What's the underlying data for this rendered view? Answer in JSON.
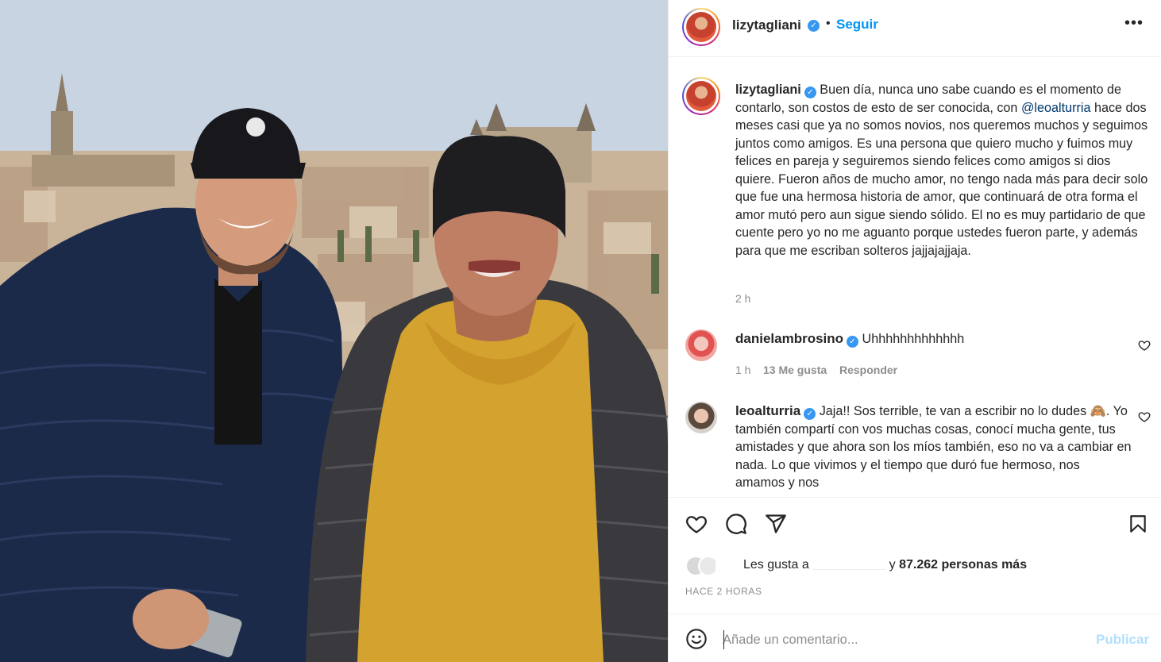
{
  "post": {
    "username": "lizytagliani",
    "follow_label": "Seguir",
    "dot": "•",
    "more_icon": "more-horizontal-icon",
    "caption_text": "Buen día, nunca uno sabe cuando es el momento de contarlo, son costos de esto de ser conocida, con",
    "caption_mention": "@leoalturria",
    "caption_rest": "hace dos meses casi que ya no somos novios, nos queremos muchos y seguimos juntos como amigos. Es una persona que quiero mucho y fuimos muy felices en pareja y seguiremos siendo felices como amigos si dios quiere. Fueron años de mucho amor, no tengo nada más para decir solo que fue una hermosa historia de amor, que continuará de otra forma el amor mutó pero aun sigue siendo sólido. El no es muy partidario de que cuente pero yo no me aguanto porque ustedes fueron parte, y además para que me escriban solteros jajjajajjaja.",
    "caption_time": "2 h"
  },
  "comments": [
    {
      "username": "danielambrosino",
      "text": "Uhhhhhhhhhhhhh",
      "time": "1 h",
      "likes": "13 Me gusta",
      "reply": "Responder"
    },
    {
      "username": "leoalturria",
      "text_before_emoji": "Jaja!! Sos terrible, te van a escribir no lo dudes",
      "emoji": "🙈",
      "text_after_emoji": ". Yo también compartí con vos muchas cosas, conocí mucha gente, tus amistades y que ahora son los míos también, eso no va a cambiar en nada. Lo que vivimos y el tiempo que duró fue hermoso, nos amamos y nos"
    }
  ],
  "likes": {
    "prefix": "Les gusta a",
    "conjunction": "y",
    "count_text": "87.262 personas más"
  },
  "post_time": "HACE 2 HORAS",
  "add_comment": {
    "placeholder": "Añade un comentario...",
    "publish_label": "Publicar"
  },
  "colors": {
    "link_blue": "#0095f6",
    "verified_blue": "#3897f0",
    "publish_disabled": "#b2dffc"
  }
}
